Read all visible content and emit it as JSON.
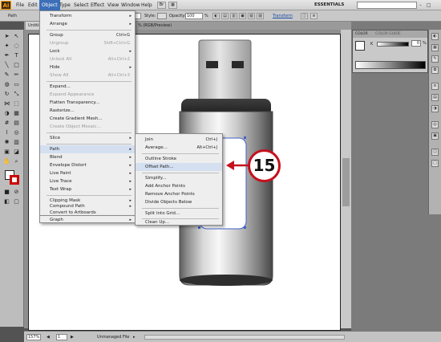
{
  "app": {
    "logo": "Ai"
  },
  "menubar": {
    "items": [
      {
        "label": "File"
      },
      {
        "label": "Edit"
      },
      {
        "label": "Object"
      },
      {
        "label": "Type"
      },
      {
        "label": "Select"
      },
      {
        "label": "Effect"
      },
      {
        "label": "View"
      },
      {
        "label": "Window"
      },
      {
        "label": "Help"
      }
    ],
    "active_item": "Object",
    "workspace": "ESSENTIALS",
    "window_buttons": "– □ ×"
  },
  "controlbar": {
    "path_label": "Path",
    "style_label": "Style:",
    "opacity_label": "Opacity:",
    "opacity_value": "100",
    "opacity_unit": "%",
    "transform_label": "Transform"
  },
  "document": {
    "tab_title": "Untitled",
    "tab_suffix": "% (RGB/Preview)"
  },
  "color_panel": {
    "tab_color": "COLOR",
    "tab_guide": "COLOR GUIDE",
    "k_label": "K",
    "k_value": "0",
    "k_unit": "%"
  },
  "statusbar": {
    "zoom": "157%",
    "page": "1",
    "info": "Unmanaged File"
  },
  "object_menu": {
    "items": [
      {
        "label": "Transform",
        "shortcut": "",
        "submenu": true,
        "disabled": false
      },
      {
        "label": "Arrange",
        "shortcut": "",
        "submenu": true,
        "disabled": false
      },
      {
        "label": "Group",
        "shortcut": "Ctrl+G",
        "submenu": false,
        "disabled": false
      },
      {
        "label": "Ungroup",
        "shortcut": "Shift+Ctrl+G",
        "submenu": false,
        "disabled": true
      },
      {
        "label": "Lock",
        "shortcut": "",
        "submenu": true,
        "disabled": false
      },
      {
        "label": "Unlock All",
        "shortcut": "Alt+Ctrl+2",
        "submenu": false,
        "disabled": true
      },
      {
        "label": "Hide",
        "shortcut": "",
        "submenu": true,
        "disabled": false
      },
      {
        "label": "Show All",
        "shortcut": "Alt+Ctrl+3",
        "submenu": false,
        "disabled": true
      },
      {
        "label": "Expand...",
        "shortcut": "",
        "submenu": false,
        "disabled": false
      },
      {
        "label": "Expand Appearance",
        "shortcut": "",
        "submenu": false,
        "disabled": true
      },
      {
        "label": "Flatten Transparency...",
        "shortcut": "",
        "submenu": false,
        "disabled": false
      },
      {
        "label": "Rasterize...",
        "shortcut": "",
        "submenu": false,
        "disabled": false
      },
      {
        "label": "Create Gradient Mesh...",
        "shortcut": "",
        "submenu": false,
        "disabled": false
      },
      {
        "label": "Create Object Mosaic...",
        "shortcut": "",
        "submenu": false,
        "disabled": true
      },
      {
        "label": "Slice",
        "shortcut": "",
        "submenu": true,
        "disabled": false
      },
      {
        "label": "Path",
        "shortcut": "",
        "submenu": true,
        "disabled": false
      },
      {
        "label": "Blend",
        "shortcut": "",
        "submenu": true,
        "disabled": false
      },
      {
        "label": "Envelope Distort",
        "shortcut": "",
        "submenu": true,
        "disabled": false
      },
      {
        "label": "Live Paint",
        "shortcut": "",
        "submenu": true,
        "disabled": false
      },
      {
        "label": "Live Trace",
        "shortcut": "",
        "submenu": true,
        "disabled": false
      },
      {
        "label": "Text Wrap",
        "shortcut": "",
        "submenu": true,
        "disabled": false
      },
      {
        "label": "Clipping Mask",
        "shortcut": "",
        "submenu": true,
        "disabled": false
      },
      {
        "label": "Compound Path",
        "shortcut": "",
        "submenu": true,
        "disabled": false
      },
      {
        "label": "Convert to Artboards",
        "shortcut": "",
        "submenu": false,
        "disabled": false
      },
      {
        "label": "Graph",
        "shortcut": "",
        "submenu": true,
        "disabled": false
      }
    ]
  },
  "path_submenu": {
    "items": [
      {
        "label": "Join",
        "shortcut": "Ctrl+J"
      },
      {
        "label": "Average...",
        "shortcut": "Alt+Ctrl+J"
      },
      {
        "label": "Outline Stroke",
        "shortcut": ""
      },
      {
        "label": "Offset Path...",
        "shortcut": ""
      },
      {
        "label": "Simplify...",
        "shortcut": ""
      },
      {
        "label": "Add Anchor Points",
        "shortcut": ""
      },
      {
        "label": "Remove Anchor Points",
        "shortcut": ""
      },
      {
        "label": "Divide Objects Below",
        "shortcut": ""
      },
      {
        "label": "Split Into Grid...",
        "shortcut": ""
      },
      {
        "label": "Clean Up...",
        "shortcut": ""
      }
    ]
  },
  "callout": {
    "number": "15"
  },
  "colors": {
    "accent": "#3c6fb8",
    "callout_red": "#c4111d",
    "menu_bg": "#eeeeee",
    "highlight": "#d4dff0"
  }
}
